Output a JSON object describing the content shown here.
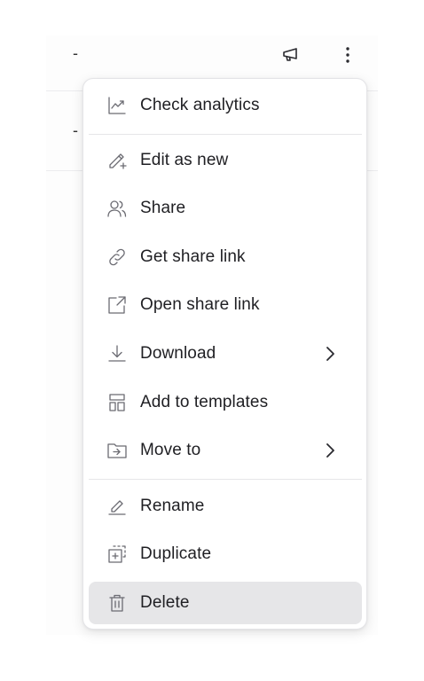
{
  "table": {
    "rows": [
      {
        "value": "-"
      },
      {
        "value": "-"
      }
    ]
  },
  "menu": {
    "items": [
      {
        "label": "Check analytics",
        "icon": "analytics-icon"
      },
      {
        "label": "Edit as new",
        "icon": "edit-plus-icon"
      },
      {
        "label": "Share",
        "icon": "users-icon"
      },
      {
        "label": "Get share link",
        "icon": "link-icon"
      },
      {
        "label": "Open share link",
        "icon": "external-link-icon"
      },
      {
        "label": "Download",
        "icon": "download-icon",
        "submenu": true
      },
      {
        "label": "Add to templates",
        "icon": "template-icon"
      },
      {
        "label": "Move to",
        "icon": "folder-move-icon",
        "submenu": true
      },
      {
        "label": "Rename",
        "icon": "rename-icon"
      },
      {
        "label": "Duplicate",
        "icon": "duplicate-icon"
      },
      {
        "label": "Delete",
        "icon": "trash-icon",
        "highlighted": true
      }
    ]
  },
  "colors": {
    "icon": "#6b6b72",
    "text": "#1f1f23",
    "highlight": "#e6e6e8",
    "border": "#e4e4e7"
  }
}
